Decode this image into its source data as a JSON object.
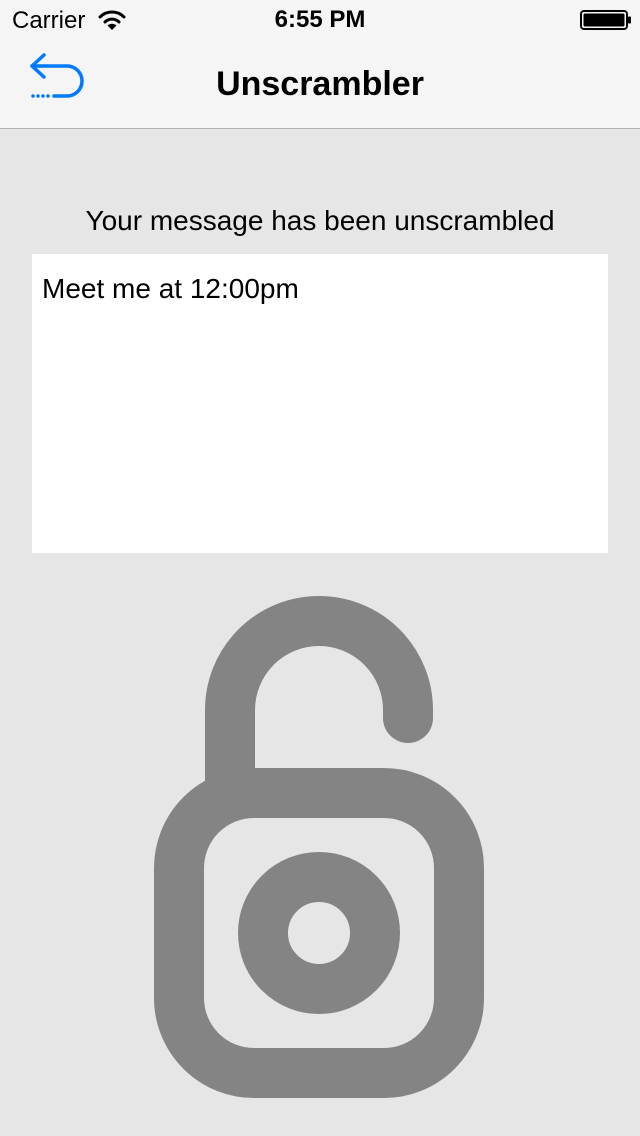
{
  "status_bar": {
    "carrier": "Carrier",
    "time": "6:55 PM",
    "wifi_icon": "wifi-icon",
    "battery_icon": "battery-icon"
  },
  "nav_bar": {
    "title": "Unscrambler",
    "back_icon": "back-arrow-icon",
    "accent_color": "#007aff"
  },
  "main": {
    "message_label": "Your message has been unscrambled",
    "message_text": "Meet me at 12:00pm",
    "lock_icon": "unlocked-padlock-icon",
    "lock_color": "#848484"
  },
  "colors": {
    "background": "#e6e6e6",
    "bar_background": "#f5f5f5"
  }
}
